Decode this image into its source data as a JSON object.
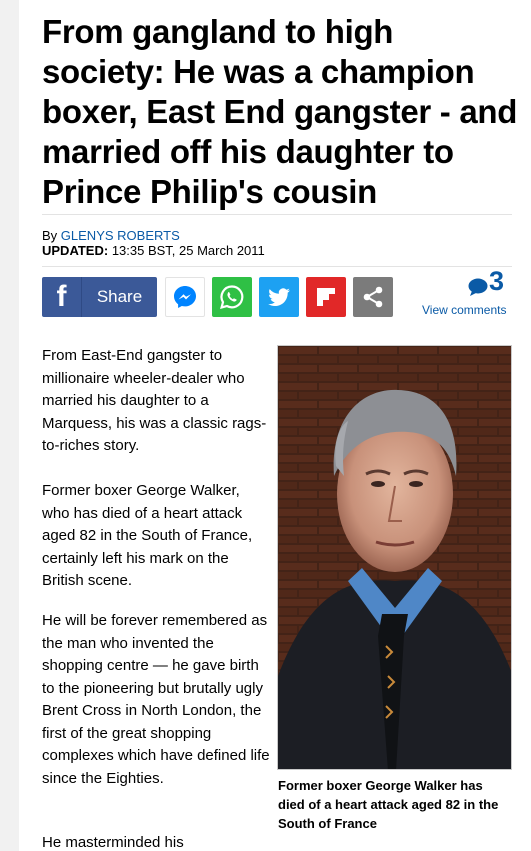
{
  "headline": "From gangland to high society: He was a champion boxer, East End gangster - and married off his daughter to Prince Philip's cousin",
  "byline": {
    "prefix": "By ",
    "author": "GLENYS ROBERTS"
  },
  "updated": {
    "label": "UPDATED:",
    "value": " 13:35 BST, 25 March 2011"
  },
  "share": {
    "facebook_label": "Share",
    "buttons": [
      "messenger-icon",
      "whatsapp-icon",
      "twitter-icon",
      "flipboard-icon",
      "share-icon"
    ]
  },
  "comments": {
    "count": "3",
    "link": "View comments"
  },
  "paragraphs": [
    "From East-End gangster to millionaire wheeler-dealer who married his daughter to a Marquess, his was a classic rags-to-riches story.",
    "Former boxer George Walker, who has died of a heart attack aged 82 in the South of France, certainly left his mark on the British scene.",
    "He will be forever remembered as the man who invented the shopping centre — he gave birth to the pioneering but brutally ugly Brent Cross in North London, the first of the great shopping complexes which have defined life since the Eighties.",
    "He masterminded his"
  ],
  "photo": {
    "caption": "Former boxer George Walker has died of a heart attack aged 82 in the South of France"
  },
  "colors": {
    "facebook": "#3b5998",
    "whatsapp": "#2fc045",
    "twitter": "#1da1f2",
    "flipboard": "#e12828",
    "share": "#7b7b7b",
    "link": "#0a5aa6"
  }
}
